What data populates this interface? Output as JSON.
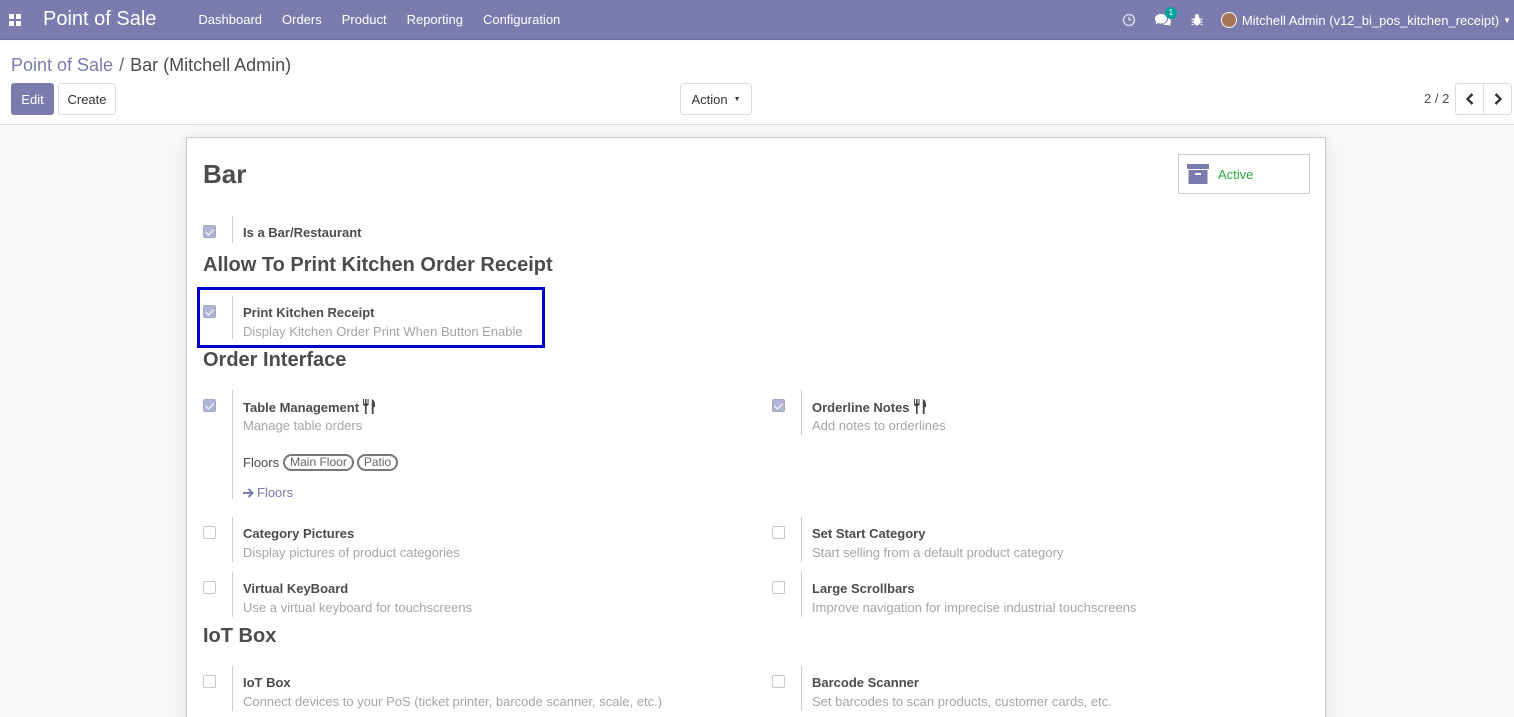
{
  "navbar": {
    "app_name": "Point of Sale",
    "menu": [
      "Dashboard",
      "Orders",
      "Product",
      "Reporting",
      "Configuration"
    ],
    "chat_badge": "1",
    "user": "Mitchell Admin (v12_bi_pos_kitchen_receipt)"
  },
  "breadcrumb": {
    "parent": "Point of Sale",
    "separator": "/",
    "current": "Bar (Mitchell Admin)"
  },
  "buttons": {
    "edit": "Edit",
    "create": "Create",
    "action": "Action"
  },
  "pager": {
    "text": "2 / 2"
  },
  "form": {
    "title": "Bar",
    "active_label": "Active",
    "is_bar": {
      "label": "Is a Bar/Restaurant",
      "checked": true
    },
    "section_kitchen": "Allow To Print Kitchen Order Receipt",
    "print_kitchen": {
      "label": "Print Kitchen Receipt",
      "desc": "Display Kitchen Order Print When Button Enable",
      "checked": true
    },
    "section_order": "Order Interface",
    "table_mgmt": {
      "label": "Table Management",
      "desc": "Manage table orders",
      "checked": true
    },
    "floors_label": "Floors",
    "floor_tags": [
      "Main Floor",
      "Patio"
    ],
    "floors_link": "Floors",
    "orderline_notes": {
      "label": "Orderline Notes",
      "desc": "Add notes to orderlines",
      "checked": true
    },
    "category_pictures": {
      "label": "Category Pictures",
      "desc": "Display pictures of product categories",
      "checked": false
    },
    "set_start_category": {
      "label": "Set Start Category",
      "desc": "Start selling from a default product category",
      "checked": false
    },
    "virtual_keyboard": {
      "label": "Virtual KeyBoard",
      "desc": "Use a virtual keyboard for touchscreens",
      "checked": false
    },
    "large_scrollbars": {
      "label": "Large Scrollbars",
      "desc": "Improve navigation for imprecise industrial touchscreens",
      "checked": false
    },
    "section_iot": "IoT Box",
    "iot_box": {
      "label": "IoT Box",
      "desc": "Connect devices to your PoS (ticket printer, barcode scanner, scale, etc.)",
      "checked": false
    },
    "barcode_scanner": {
      "label": "Barcode Scanner",
      "desc": "Set barcodes to scan products, customer cards, etc.",
      "checked": false
    }
  },
  "colors": {
    "brand": "#7c7bad",
    "checkbox_checked": "#b1b4d5",
    "active_green": "#28a745",
    "highlight": "#0000cc"
  }
}
